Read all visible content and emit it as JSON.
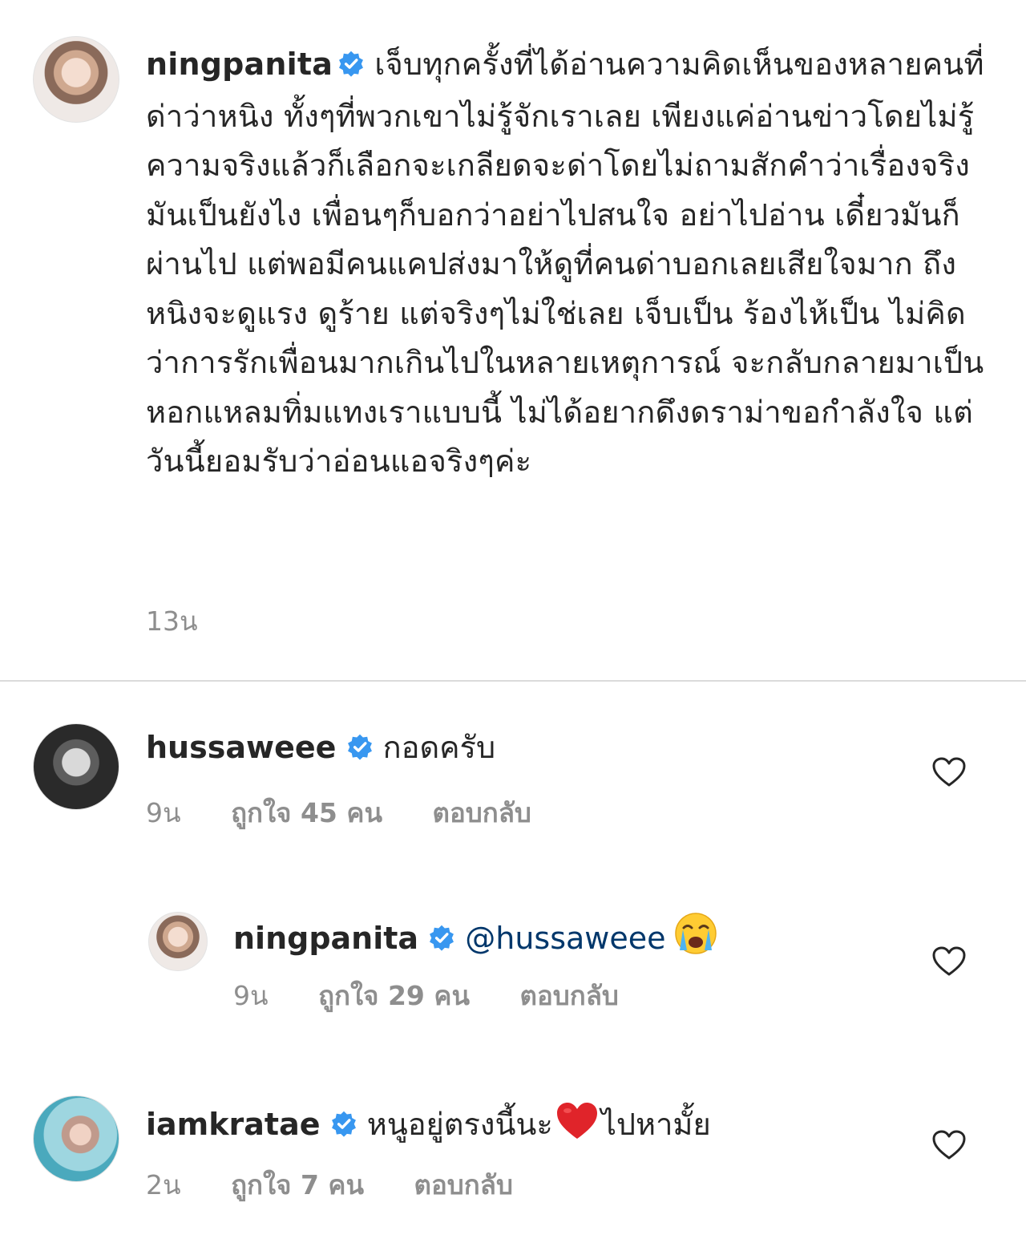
{
  "post": {
    "avatar_icon": "profile-photo-ningpanita",
    "username": "ningpanita",
    "verified_icon": "verified-badge-icon",
    "caption": "เจ็บทุกครั้งที่ได้อ่านความคิดเห็นของหลายคนที่ด่าว่าหนิง ทั้งๆที่พวกเขาไม่รู้จักเราเลย เพียงแค่อ่านข่าวโดยไม่รู้ความจริงแล้วก็เลือกจะเกลียดจะด่าโดยไม่ถามสักคำว่าเรื่องจริงมันเป็นยังไง เพื่อนๆก็บอกว่าอย่าไปสนใจ อย่าไปอ่าน เดี๋ยวมันก็ผ่านไป แต่พอมีคนแคปส่งมาให้ดูที่คนด่าบอกเลยเสียใจมาก ถึงหนิงจะดูแรง ดูร้าย แต่จริงๆไม่ใช่เลย เจ็บเป็น ร้องไห้เป็น ไม่คิดว่าการรักเพื่อนมากเกินไปในหลายเหตุการณ์ จะกลับกลายมาเป็นหอกแหลมทิ่มแทงเราแบบนี้ ไม่ได้อยากดึงดราม่าขอกำลังใจ แต่วันนี้ยอมรับว่าอ่อนแอจริงๆค่ะ",
    "time": "13น"
  },
  "comments": [
    {
      "avatar_icon": "profile-photo-hussaweee",
      "username": "hussaweee",
      "text": "กอดครับ",
      "time": "9น",
      "likes": "ถูกใจ 45 คน",
      "reply": "ตอบกลับ",
      "like_icon": "heart-outline-icon"
    },
    {
      "avatar_icon": "profile-photo-ningpanita",
      "username": "ningpanita",
      "mention": "@hussaweee",
      "emoji": "crying-face-emoji",
      "time": "9น",
      "likes": "ถูกใจ 29 คน",
      "reply": "ตอบกลับ",
      "like_icon": "heart-outline-icon"
    },
    {
      "avatar_icon": "profile-photo-iamkratae",
      "username": "iamkratae",
      "text_before": "หนูอยู่ตรงนี้นะ",
      "emoji": "red-heart-emoji",
      "text_after": "ไปหามั้ย",
      "time": "2น",
      "likes": "ถูกใจ 7 คน",
      "reply": "ตอบกลับ",
      "like_icon": "heart-outline-icon"
    }
  ],
  "colors": {
    "verified": "#3897f0",
    "mention": "#00376b",
    "meta": "#8e8e8e",
    "divider": "#dbdbdb"
  }
}
